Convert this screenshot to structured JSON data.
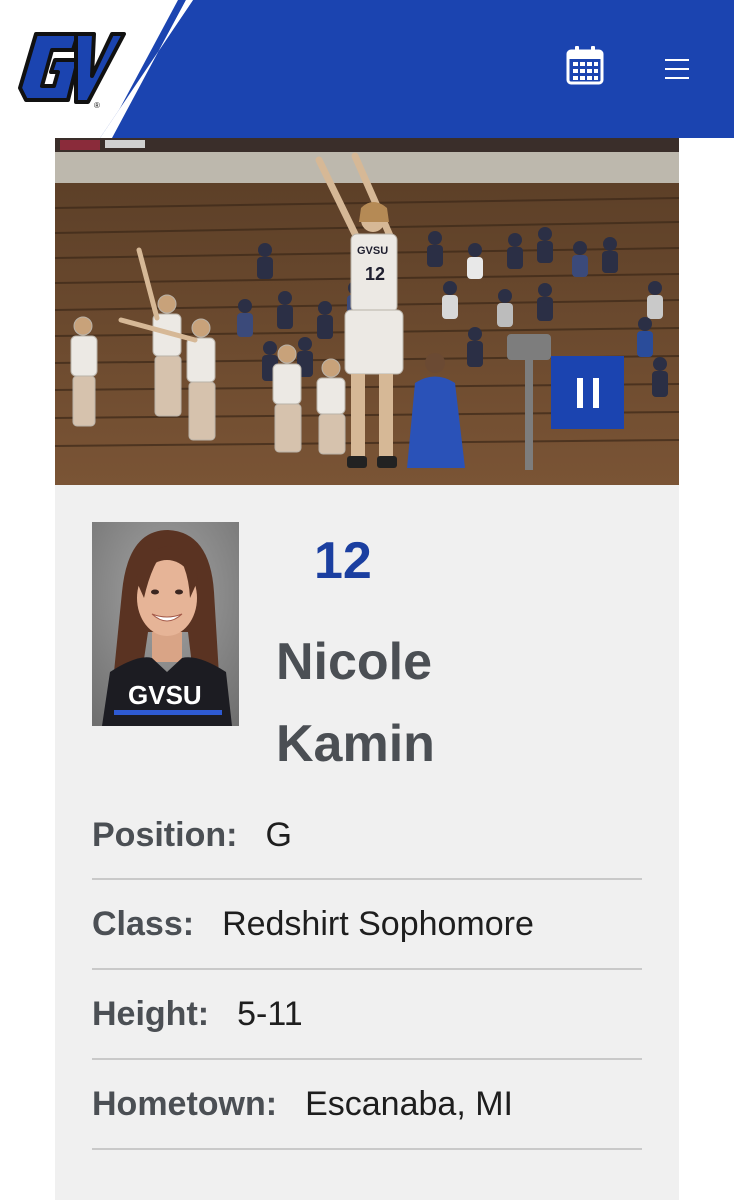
{
  "header": {
    "logo_text": "GV",
    "calendar_icon": "calendar-icon",
    "menu_icon": "hamburger-menu-icon",
    "brand_color": "#1b44b0"
  },
  "hero": {
    "pause_icon": "pause-icon",
    "jersey_text": "GVSU",
    "jersey_number": "12"
  },
  "player": {
    "number": "12",
    "first_name": "Nicole",
    "last_name": "Kamin",
    "headshot_jersey_text": "GVSU"
  },
  "bio": [
    {
      "label": "Position:",
      "value": "G"
    },
    {
      "label": "Class:",
      "value": "Redshirt Sophomore"
    },
    {
      "label": "Height:",
      "value": "5-11"
    },
    {
      "label": "Hometown:",
      "value": "Escanaba, MI"
    }
  ],
  "colors": {
    "accent_blue": "#1b44b0",
    "number_blue": "#1b3fa0",
    "label_gray": "#4b4f54",
    "card_bg": "#f0f0f0"
  }
}
